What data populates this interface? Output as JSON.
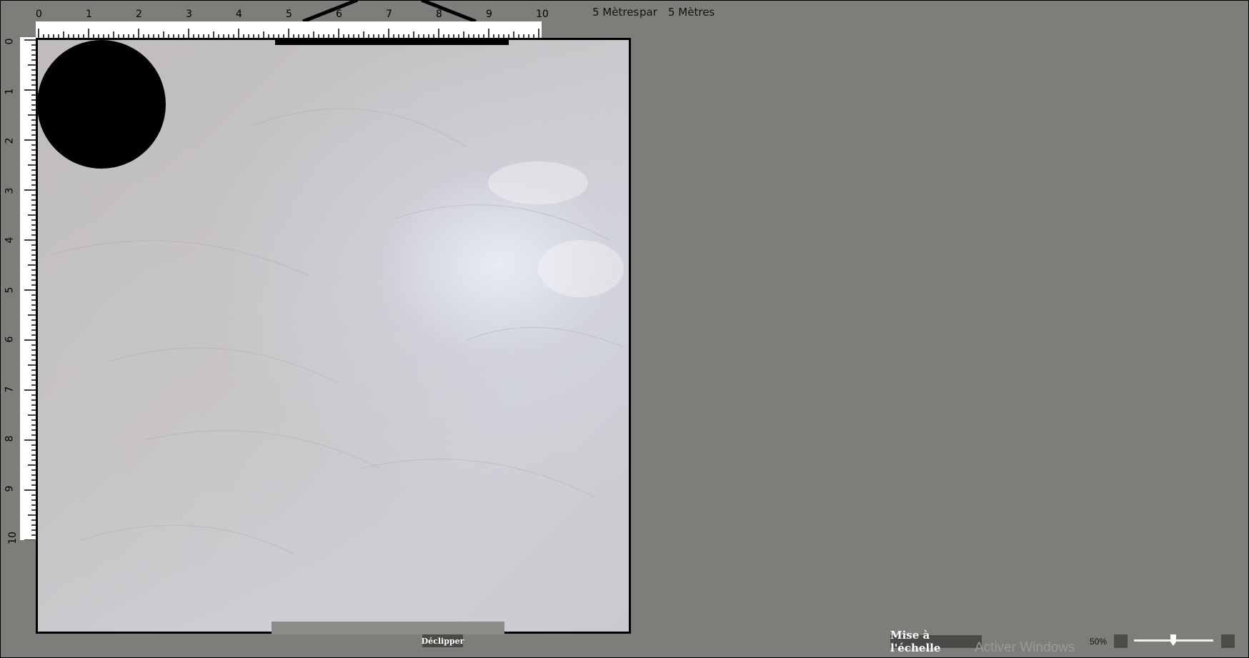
{
  "scale": {
    "width_value": "5 Mètres",
    "connector": "par",
    "height_value": "5 Mètres"
  },
  "ruler": {
    "h_labels": [
      "0",
      "1",
      "2",
      "3",
      "4",
      "5",
      "6",
      "7",
      "8",
      "9",
      "10"
    ],
    "v_labels": [
      "0",
      "1",
      "2",
      "3",
      "4",
      "5",
      "6",
      "7",
      "8",
      "9",
      "10"
    ]
  },
  "buttons": {
    "declipper": "Déclipper",
    "mise_echelle": "Mise à l'échelle"
  },
  "zoom": {
    "percent_label": "50%",
    "level": 0.5
  },
  "watermark": "Activer Windows",
  "colors": {
    "background": "#7d7e79",
    "button": "#4a4a48",
    "canvas_border": "#000000"
  }
}
